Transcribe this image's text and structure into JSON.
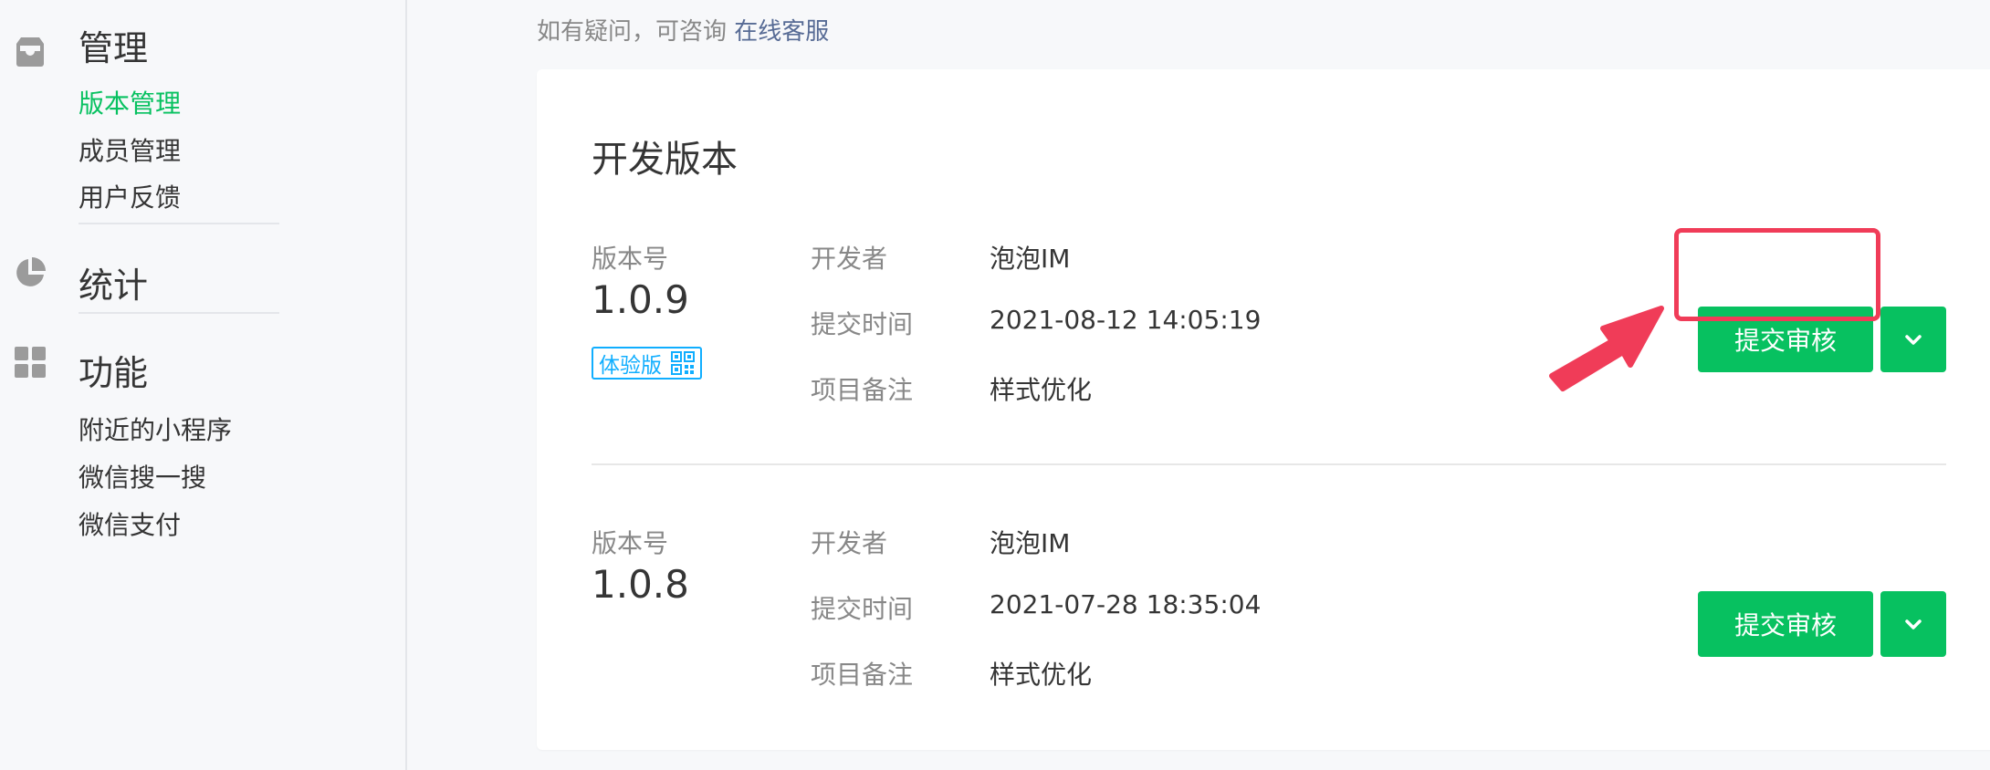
{
  "sidebar": {
    "sections": [
      {
        "title": "管理",
        "icon": "inbox-icon",
        "items": [
          {
            "label": "版本管理",
            "active": true
          },
          {
            "label": "成员管理",
            "active": false
          },
          {
            "label": "用户反馈",
            "active": false
          }
        ]
      },
      {
        "title": "统计",
        "icon": "pie-chart-icon",
        "items": []
      },
      {
        "title": "功能",
        "icon": "grid-icon",
        "items": [
          {
            "label": "附近的小程序",
            "active": false
          },
          {
            "label": "微信搜一搜",
            "active": false
          },
          {
            "label": "微信支付",
            "active": false
          }
        ]
      }
    ]
  },
  "notice": {
    "text": "如有疑问，可咨询",
    "link": "在线客服"
  },
  "card": {
    "title": "开发版本",
    "versions": [
      {
        "label": "版本号",
        "number": "1.0.9",
        "tag": "体验版",
        "fields": [
          {
            "label": "开发者",
            "value": "泡泡IM"
          },
          {
            "label": "提交时间",
            "value": "2021-08-12 14:05:19"
          },
          {
            "label": "项目备注",
            "value": "样式优化"
          }
        ],
        "submit_label": "提交审核"
      },
      {
        "label": "版本号",
        "number": "1.0.8",
        "fields": [
          {
            "label": "开发者",
            "value": "泡泡IM"
          },
          {
            "label": "提交时间",
            "value": "2021-07-28 18:35:04"
          },
          {
            "label": "项目备注",
            "value": "样式优化"
          }
        ],
        "submit_label": "提交审核"
      }
    ]
  },
  "colors": {
    "accent": "#07c160",
    "link": "#576b95",
    "tag": "#10aeff",
    "annotation": "#f03c58"
  }
}
